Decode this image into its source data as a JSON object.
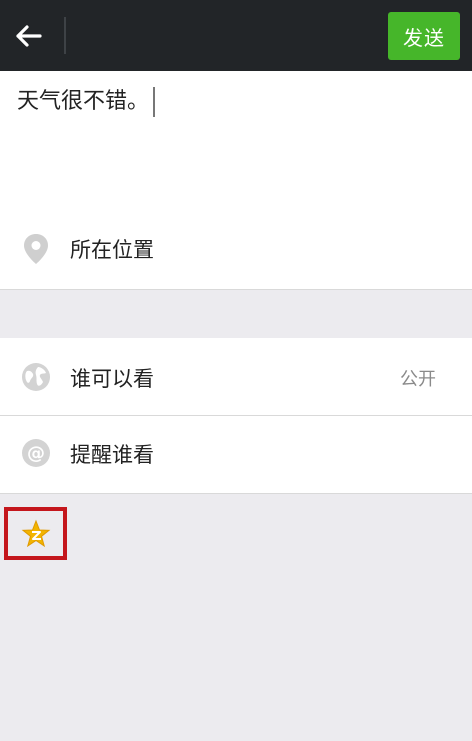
{
  "topbar": {
    "back_icon": "arrow-left-icon",
    "send_label": "发送",
    "send_color": "#46b62a"
  },
  "compose": {
    "text": "天气很不错。"
  },
  "location": {
    "icon": "location-pin-icon",
    "label": "所在位置"
  },
  "visibility": {
    "icon": "globe-icon",
    "label": "谁可以看",
    "value": "公开"
  },
  "mention": {
    "icon": "at-icon",
    "label": "提醒谁看"
  },
  "extra": {
    "icon": "star-badge-icon",
    "highlight_color": "#c4161c"
  }
}
